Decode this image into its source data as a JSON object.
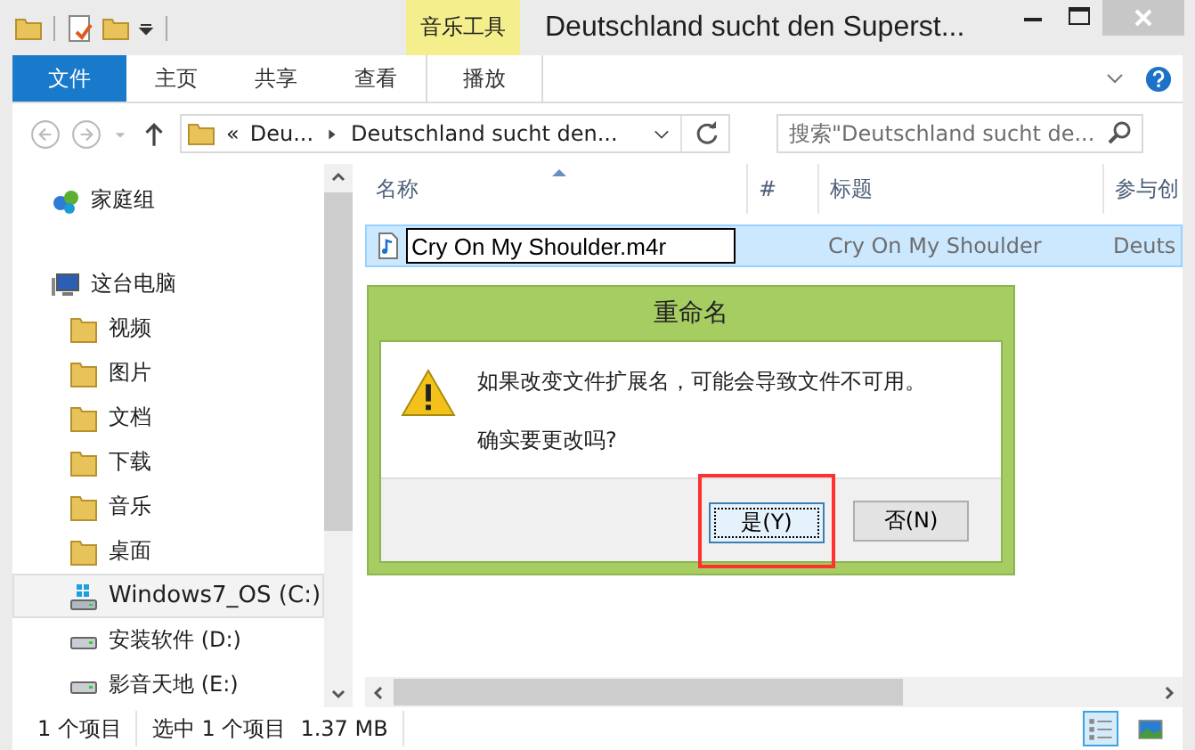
{
  "window": {
    "title": "Deutschland sucht den Superst...",
    "contextual_tab": "音乐工具"
  },
  "ribbon_tabs": [
    {
      "label": "文件",
      "kind": "file",
      "selected": false
    },
    {
      "label": "主页",
      "kind": "tab",
      "selected": false
    },
    {
      "label": "共享",
      "kind": "tab",
      "selected": false
    },
    {
      "label": "查看",
      "kind": "tab",
      "selected": false
    },
    {
      "label": "播放",
      "kind": "context",
      "selected": false
    }
  ],
  "address_bar": {
    "overflow": "«",
    "segments": [
      "Deu...",
      "Deutschland sucht den..."
    ]
  },
  "search": {
    "placeholder": "搜索\"Deutschland sucht de..."
  },
  "nav_pane": {
    "items": [
      {
        "label": "家庭组",
        "kind": "homegroup",
        "selected": false
      },
      {
        "label": "这台电脑",
        "kind": "pc",
        "selected": false,
        "children": [
          {
            "label": "视频",
            "kind": "folder",
            "selected": false
          },
          {
            "label": "图片",
            "kind": "folder",
            "selected": false
          },
          {
            "label": "文档",
            "kind": "folder",
            "selected": false
          },
          {
            "label": "下载",
            "kind": "folder",
            "selected": false
          },
          {
            "label": "音乐",
            "kind": "folder",
            "selected": false
          },
          {
            "label": "桌面",
            "kind": "folder",
            "selected": false
          },
          {
            "label": "Windows7_OS (C:)",
            "kind": "osdrive",
            "selected": true
          },
          {
            "label": "安装软件 (D:)",
            "kind": "drive",
            "selected": false
          },
          {
            "label": "影音天地 (E:)",
            "kind": "drive",
            "selected": false
          }
        ]
      }
    ]
  },
  "table": {
    "columns": [
      "名称",
      "#",
      "标题",
      "参与创"
    ],
    "rows": [
      {
        "name": "Cry On My Shoulder.m4r",
        "title": "Cry On My Shoulder",
        "column_4": "Deuts",
        "selected": true,
        "editing": true
      }
    ]
  },
  "dialog": {
    "title": "重命名",
    "message": "如果改变文件扩展名，可能会导致文件不可用。",
    "question": "确实要更改吗?",
    "buttons": [
      {
        "label": "是(Y)",
        "default": true,
        "highlighted": true
      },
      {
        "label": "否(N)",
        "default": false,
        "highlighted": false
      }
    ]
  },
  "status_bar": {
    "count": "1 个项目",
    "selection": "选中 1 个项目",
    "size": "1.37 MB",
    "views": [
      {
        "kind": "details",
        "selected": true
      },
      {
        "kind": "thumbnails",
        "selected": false
      }
    ]
  }
}
